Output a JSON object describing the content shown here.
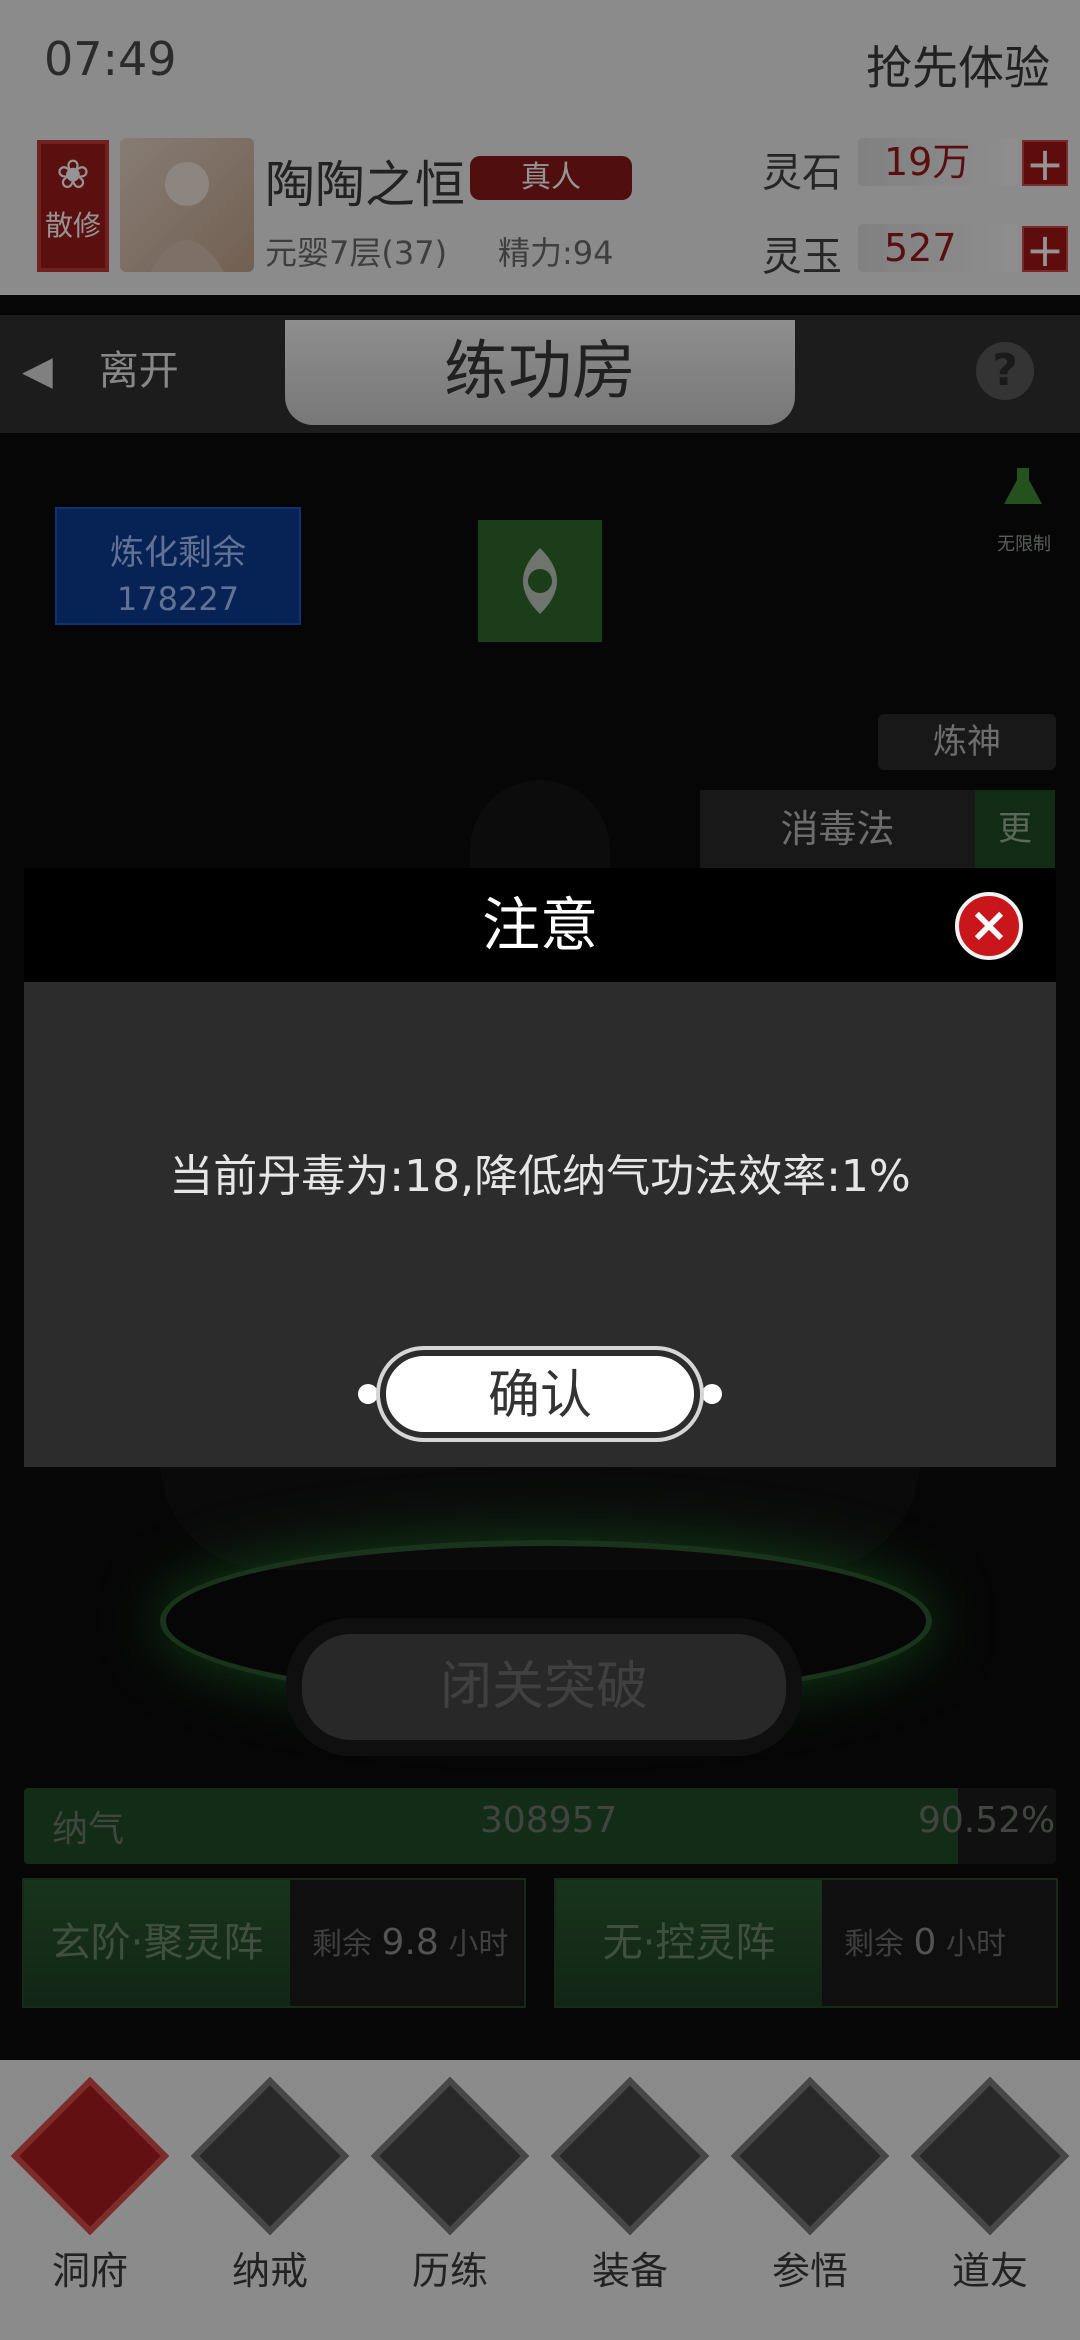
{
  "status": {
    "time": "07:49",
    "early_access": "抢先体验"
  },
  "profile": {
    "sect": "散修",
    "name": "陶陶之恒",
    "badge": "真人",
    "realm": "元婴7层(37)",
    "energy": "精力:94"
  },
  "resources": [
    {
      "label": "灵石",
      "value": "19万"
    },
    {
      "label": "灵玉",
      "value": "527"
    }
  ],
  "header": {
    "leave": "离开",
    "title": "练功房"
  },
  "main": {
    "refine_label": "炼化剩余",
    "refine_value": "178227",
    "unlimited": "无限制",
    "refine_god": "炼神",
    "method": "消毒法",
    "change": "更",
    "breakthrough": "闭关突破",
    "qi_label": "纳气",
    "qi_value": "308957",
    "qi_percent": "90.52%",
    "qi_progress": 0.9052,
    "arrays": [
      {
        "name": "玄阶·聚灵阵",
        "rest_prefix": "剩余",
        "rest_value": "9.8",
        "rest_unit": "小时"
      },
      {
        "name": "无·控灵阵",
        "rest_prefix": "剩余",
        "rest_value": "0",
        "rest_unit": "小时"
      }
    ]
  },
  "nav": [
    {
      "label": "洞府",
      "active": true
    },
    {
      "label": "纳戒",
      "active": false
    },
    {
      "label": "历练",
      "active": false
    },
    {
      "label": "装备",
      "active": false
    },
    {
      "label": "参悟",
      "active": false
    },
    {
      "label": "道友",
      "active": false
    }
  ],
  "dialog": {
    "title": "注意",
    "message": "当前丹毒为:18,降低纳气功法效率:1%",
    "confirm": "确认"
  }
}
